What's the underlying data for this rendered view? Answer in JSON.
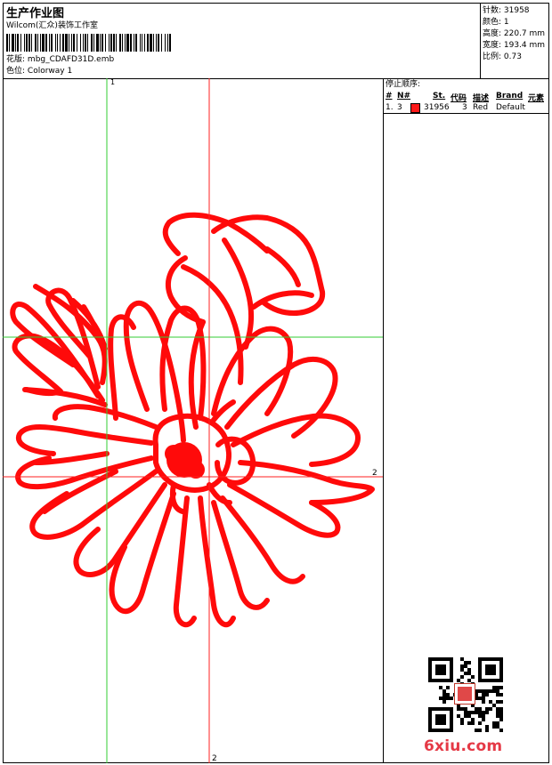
{
  "header": {
    "title": "生产作业图",
    "company": "Wilcom(汇众)装饰工作室",
    "design_label": "花版:",
    "design_file": "mbg_CDAFD31D.emb",
    "color_label": "色位:",
    "colorway": "Colorway 1"
  },
  "stats": {
    "stitches": "针数: 31958",
    "colors": "颜色: 1",
    "height": "高度: 220.7 mm",
    "width": "宽度: 193.4 mm",
    "scale": "比例: 0.73"
  },
  "stop_sequence": {
    "title": "停止顺序:",
    "columns": [
      "#",
      "N#",
      "St.",
      "代码",
      "描述",
      "Brand",
      "元素"
    ],
    "rows": [
      {
        "index": "1.",
        "needle": "3",
        "color": "#ff1a1a",
        "stitches": "31956",
        "code": "3",
        "description": "Red",
        "brand": "Default",
        "element": ""
      }
    ]
  },
  "guides": {
    "green_label": "1",
    "red_label_right": "2",
    "red_label_bottom": "2",
    "green_color": "#33cc33",
    "red_color": "#ff2020"
  },
  "design": {
    "stroke_color": "#ff0a0a"
  },
  "watermark": {
    "text": "6xiu.com"
  }
}
